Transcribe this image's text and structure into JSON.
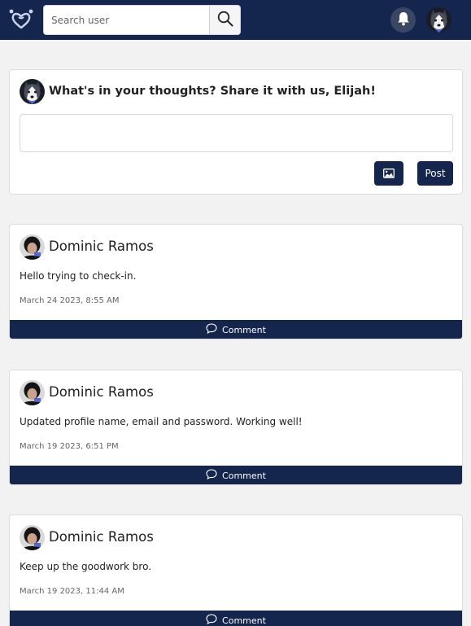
{
  "navbar": {
    "search_placeholder": "Search user",
    "icons": [
      "heart-logo-icon",
      "search-icon",
      "bell-icon"
    ],
    "colors": {
      "primary": "#14254e",
      "bell_bg": "#3b4662"
    }
  },
  "composer": {
    "title": "What's in your thoughts? Share it with us, Elijah!",
    "post_label": "Post",
    "image_icon": "image-icon"
  },
  "posts": [
    {
      "author": "Dominic Ramos",
      "text": "Hello trying to check-in.",
      "time": "March 24 2023, 8:55 AM",
      "comment_label": "Comment"
    },
    {
      "author": "Dominic Ramos",
      "text": "Updated profile name, email and password. Working well!",
      "time": "March 19 2023, 6:51 PM",
      "comment_label": "Comment"
    },
    {
      "author": "Dominic Ramos",
      "text": "Keep up the goodwork bro.",
      "time": "March 19 2023, 11:44 AM",
      "comment_label": "Comment"
    }
  ]
}
